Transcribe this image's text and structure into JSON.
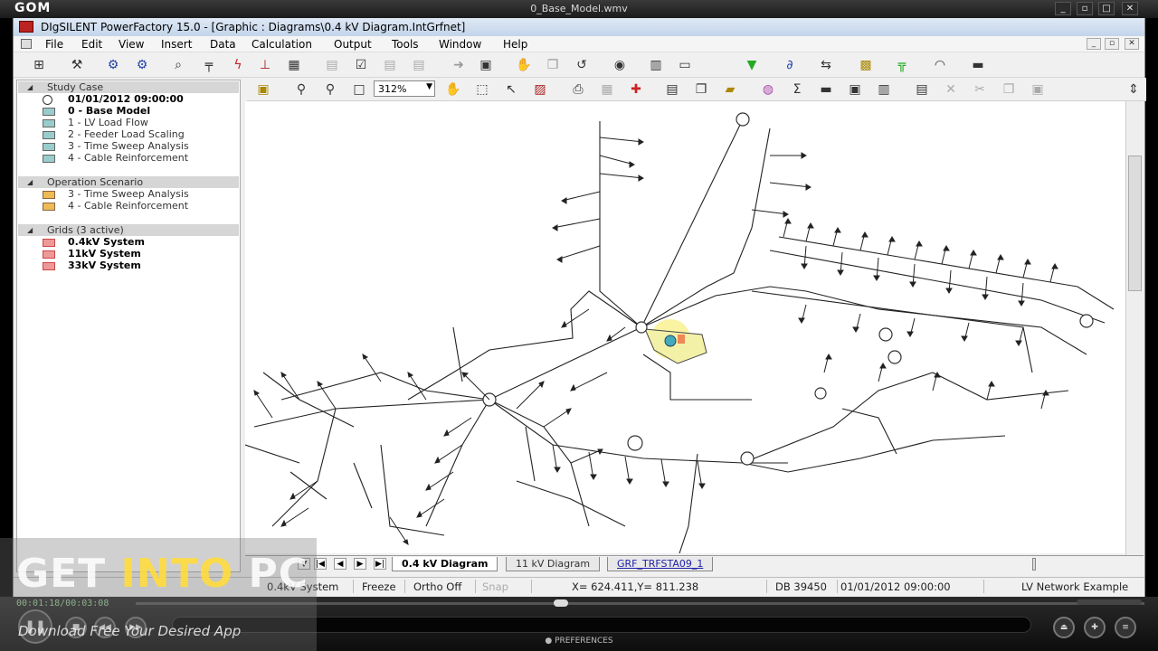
{
  "player": {
    "logo": "GOM",
    "filename": "0_Base_Model.wmv",
    "time": "00:01:18/00:03:08",
    "preferences": "PREFERENCES",
    "progress_fraction": 0.42
  },
  "app": {
    "title": "DIgSILENT PowerFactory 15.0 - [Graphic : Diagrams\\0.4 kV Diagram.IntGrfnet]"
  },
  "menu": [
    "File",
    "Edit",
    "View",
    "Insert",
    "Data",
    "Calculation",
    "Output",
    "Tools",
    "Window",
    "Help"
  ],
  "toolbar": {
    "zoom_value": "312%"
  },
  "tree": {
    "study_case": {
      "header": "Study Case",
      "items": [
        {
          "label": "01/01/2012 09:00:00",
          "bold": true
        },
        {
          "label": "0 - Base Model",
          "bold": true
        },
        {
          "label": "1 - LV Load Flow",
          "bold": false
        },
        {
          "label": "2 - Feeder Load Scaling",
          "bold": false
        },
        {
          "label": "3 - Time Sweep Analysis",
          "bold": false
        },
        {
          "label": "4 - Cable Reinforcement",
          "bold": false
        }
      ]
    },
    "operation_scenario": {
      "header": "Operation Scenario",
      "items": [
        {
          "label": "3 - Time Sweep Analysis"
        },
        {
          "label": "4 - Cable Reinforcement"
        }
      ]
    },
    "grids": {
      "header": "Grids (3 active)",
      "items": [
        {
          "label": "0.4kV System"
        },
        {
          "label": "11kV System"
        },
        {
          "label": "33kV System"
        }
      ]
    }
  },
  "tabs": [
    {
      "label": "0.4 kV Diagram",
      "active": true
    },
    {
      "label": "11 kV Diagram",
      "active": false
    },
    {
      "label": "GRF_TRFSTA09_1",
      "active": false
    }
  ],
  "status": {
    "grid": "0.4kV System",
    "freeze": "Freeze",
    "ortho": "Ortho Off",
    "snap": "Snap",
    "coords": "X=   624.411,Y=   811.238",
    "db": "DB 39450",
    "datetime": "01/01/2012 09:00:00",
    "project": "LV Network Example"
  },
  "watermark": {
    "title_a": "GET ",
    "title_b": "INTO",
    "title_c": " PC",
    "subtitle": "Download Free Your Desired App"
  }
}
